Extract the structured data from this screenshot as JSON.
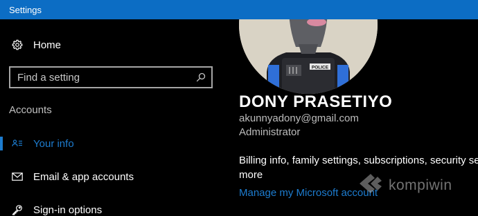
{
  "window": {
    "title": "Settings"
  },
  "sidebar": {
    "home": {
      "label": "Home",
      "icon": "gear-icon"
    },
    "search": {
      "placeholder": "Find a setting",
      "value": "",
      "icon": "search-icon"
    },
    "section_heading": "Accounts",
    "items": [
      {
        "label": "Your info",
        "icon": "person-card-icon",
        "selected": true
      },
      {
        "label": "Email & app accounts",
        "icon": "mail-icon",
        "selected": false
      },
      {
        "label": "Sign-in options",
        "icon": "key-icon",
        "selected": false
      }
    ]
  },
  "profile": {
    "name": "DONY PRASETIYO",
    "email": "akunnyadony@gmail.com",
    "role": "Administrator",
    "billing_line1": "Billing info, family settings, subscriptions, security settings, and",
    "billing_line2": "more",
    "manage_link": "Manage my Microsoft account",
    "avatar_badge": "POLICE"
  },
  "watermark": {
    "text": "kompiwin"
  },
  "colors": {
    "titlebar": "#0c6dc4",
    "accent": "#1d7ccf",
    "background": "#000000"
  }
}
